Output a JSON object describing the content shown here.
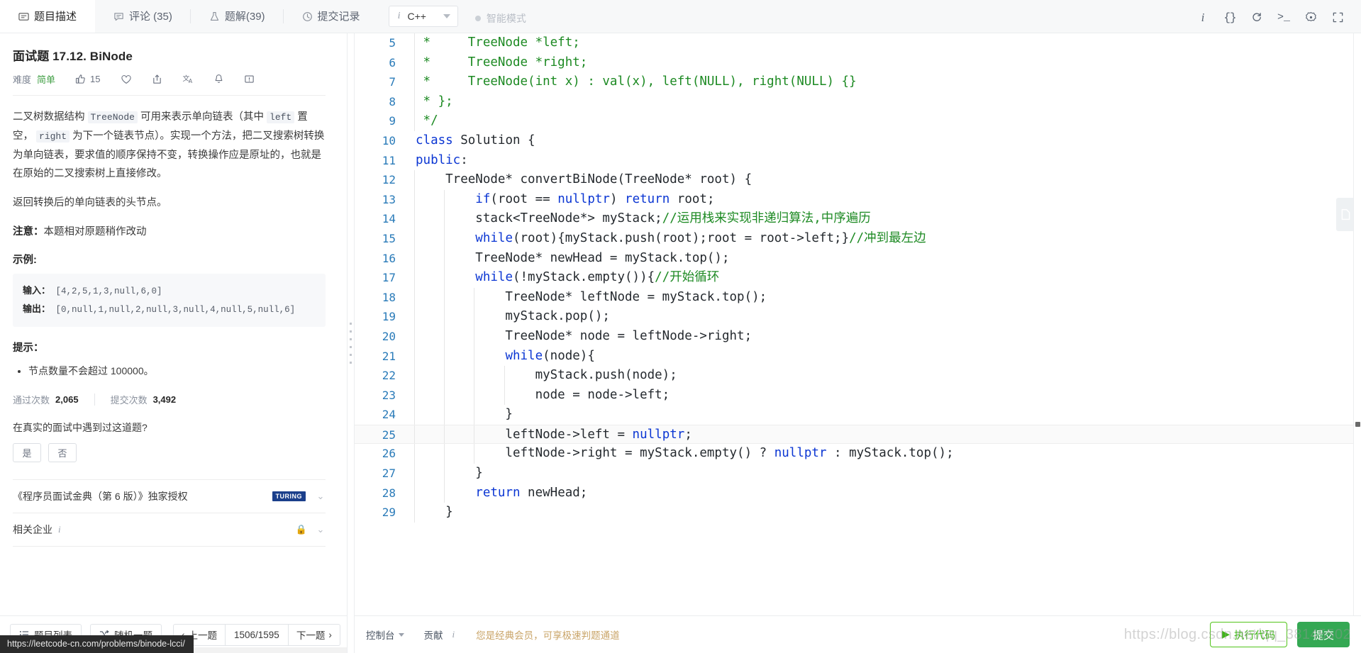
{
  "topbar": {
    "tabs": [
      {
        "label": "题目描述",
        "icon": "description-icon",
        "active": true
      },
      {
        "label": "评论 (35)",
        "icon": "comment-icon",
        "active": false
      },
      {
        "label": "题解(39)",
        "icon": "flask-icon",
        "active": false
      },
      {
        "label": "提交记录",
        "icon": "clock-icon",
        "active": false
      }
    ],
    "language": {
      "value": "C++",
      "info_mark": "i"
    },
    "smart_mode": {
      "label": "智能模式"
    },
    "tools": [
      {
        "name": "info-icon",
        "glyph": "i"
      },
      {
        "name": "format-braces-icon",
        "glyph": "{}"
      },
      {
        "name": "reset-icon",
        "glyph": "↺"
      },
      {
        "name": "console-icon",
        "glyph": ">_"
      },
      {
        "name": "settings-gear-icon",
        "glyph": "⚙"
      },
      {
        "name": "fullscreen-icon",
        "glyph": "⛶"
      }
    ]
  },
  "problem": {
    "title": "面试题 17.12. BiNode",
    "difficulty_label": "难度",
    "difficulty_value": "简单",
    "like_count": "15",
    "actions": [
      "thumbs-up",
      "heart",
      "share",
      "translate",
      "bell",
      "feedback"
    ],
    "desc_p1_a": "二叉树数据结构 ",
    "desc_code_treenode": "TreeNode",
    "desc_p1_b": " 可用来表示单向链表（其中 ",
    "desc_code_left": "left",
    "desc_p1_c": " 置空， ",
    "desc_code_right": "right",
    "desc_p1_d": " 为下一个链表节点）。实现一个方法，把二叉搜索树转换为单向链表，要求值的顺序保持不变，转换操作应是原址的，也就是在原始的二叉搜索树上直接修改。",
    "desc_p2": "返回转换后的单向链表的头节点。",
    "note_label": "注意：",
    "note_text": "本题相对原题稍作改动",
    "example_heading": "示例:",
    "example_input_label": "输入：",
    "example_input_value": "[4,2,5,1,3,null,6,0]",
    "example_output_label": "输出：",
    "example_output_value": "[0,null,1,null,2,null,3,null,4,null,5,null,6]",
    "hint_heading": "提示：",
    "hints": [
      "节点数量不会超过 100000。"
    ],
    "stats": {
      "accepted_label": "通过次数",
      "accepted_value": "2,065",
      "submitted_label": "提交次数",
      "submitted_value": "3,492"
    },
    "interview_question": "在真实的面试中遇到过这道题?",
    "yes_label": "是",
    "no_label": "否",
    "copyright_row": "《程序员面试金典（第 6 版）》独家授权",
    "turing_logo": "TURING",
    "companies_row": "相关企业"
  },
  "left_bottom": {
    "problem_list_label": "题目列表",
    "random_label": "随机一题",
    "prev_label": "上一题",
    "page_indicator": "1506/1595",
    "next_label": "下一题"
  },
  "editor": {
    "lines": [
      {
        "num": "5",
        "indent": 1,
        "tokens": [
          {
            "t": " *     TreeNode *left;",
            "c": "cmt"
          }
        ]
      },
      {
        "num": "6",
        "indent": 1,
        "tokens": [
          {
            "t": " *     TreeNode *right;",
            "c": "cmt"
          }
        ]
      },
      {
        "num": "7",
        "indent": 1,
        "tokens": [
          {
            "t": " *     TreeNode(int x) : val(x), left(NULL), right(NULL) {}",
            "c": "cmt"
          }
        ]
      },
      {
        "num": "8",
        "indent": 1,
        "tokens": [
          {
            "t": " * };",
            "c": "cmt"
          }
        ]
      },
      {
        "num": "9",
        "indent": 1,
        "tokens": [
          {
            "t": " */",
            "c": "cmt"
          }
        ]
      },
      {
        "num": "10",
        "indent": 0,
        "tokens": [
          {
            "t": "class",
            "c": "kw"
          },
          {
            "t": " Solution {",
            "c": ""
          }
        ]
      },
      {
        "num": "11",
        "indent": 0,
        "tokens": [
          {
            "t": "public",
            "c": "kw"
          },
          {
            "t": ":",
            "c": ""
          }
        ]
      },
      {
        "num": "12",
        "indent": 1,
        "tokens": [
          {
            "t": "    TreeNode* convertBiNode(TreeNode* root) {",
            "c": ""
          }
        ]
      },
      {
        "num": "13",
        "indent": 2,
        "tokens": [
          {
            "t": "        ",
            "c": ""
          },
          {
            "t": "if",
            "c": "kw"
          },
          {
            "t": "(root == ",
            "c": ""
          },
          {
            "t": "nullptr",
            "c": "kw"
          },
          {
            "t": ") ",
            "c": ""
          },
          {
            "t": "return",
            "c": "kw"
          },
          {
            "t": " root;",
            "c": ""
          }
        ]
      },
      {
        "num": "14",
        "indent": 2,
        "tokens": [
          {
            "t": "        stack<TreeNode*> myStack;",
            "c": ""
          },
          {
            "t": "//运用栈来实现非递归算法,中序遍历",
            "c": "cmt"
          }
        ]
      },
      {
        "num": "15",
        "indent": 2,
        "tokens": [
          {
            "t": "        ",
            "c": ""
          },
          {
            "t": "while",
            "c": "kw"
          },
          {
            "t": "(root){myStack.push(root);root = root->left;}",
            "c": ""
          },
          {
            "t": "//冲到最左边",
            "c": "cmt"
          }
        ]
      },
      {
        "num": "16",
        "indent": 2,
        "tokens": [
          {
            "t": "        TreeNode* newHead = myStack.top();",
            "c": ""
          }
        ]
      },
      {
        "num": "17",
        "indent": 2,
        "tokens": [
          {
            "t": "        ",
            "c": ""
          },
          {
            "t": "while",
            "c": "kw"
          },
          {
            "t": "(!myStack.empty()){",
            "c": ""
          },
          {
            "t": "//开始循环",
            "c": "cmt"
          }
        ]
      },
      {
        "num": "18",
        "indent": 3,
        "tokens": [
          {
            "t": "            TreeNode* leftNode = myStack.top();",
            "c": ""
          }
        ]
      },
      {
        "num": "19",
        "indent": 3,
        "tokens": [
          {
            "t": "            myStack.pop();",
            "c": ""
          }
        ]
      },
      {
        "num": "20",
        "indent": 3,
        "tokens": [
          {
            "t": "            TreeNode* node = leftNode->right;",
            "c": ""
          }
        ]
      },
      {
        "num": "21",
        "indent": 3,
        "tokens": [
          {
            "t": "            ",
            "c": ""
          },
          {
            "t": "while",
            "c": "kw"
          },
          {
            "t": "(node){",
            "c": ""
          }
        ]
      },
      {
        "num": "22",
        "indent": 4,
        "tokens": [
          {
            "t": "                myStack.push(node);",
            "c": ""
          }
        ]
      },
      {
        "num": "23",
        "indent": 4,
        "tokens": [
          {
            "t": "                node = node->left;",
            "c": ""
          }
        ]
      },
      {
        "num": "24",
        "indent": 3,
        "tokens": [
          {
            "t": "            }",
            "c": ""
          }
        ]
      },
      {
        "num": "25",
        "indent": 3,
        "current": true,
        "tokens": [
          {
            "t": "            leftNode->left = ",
            "c": ""
          },
          {
            "t": "nullptr",
            "c": "kw"
          },
          {
            "t": ";",
            "c": ""
          }
        ]
      },
      {
        "num": "26",
        "indent": 3,
        "tokens": [
          {
            "t": "            leftNode->right = myStack.empty() ? ",
            "c": ""
          },
          {
            "t": "nullptr",
            "c": "kw"
          },
          {
            "t": " : myStack.top();",
            "c": ""
          }
        ]
      },
      {
        "num": "27",
        "indent": 2,
        "tokens": [
          {
            "t": "        }",
            "c": ""
          }
        ]
      },
      {
        "num": "28",
        "indent": 2,
        "tokens": [
          {
            "t": "        ",
            "c": ""
          },
          {
            "t": "return",
            "c": "kw"
          },
          {
            "t": " newHead;",
            "c": ""
          }
        ]
      },
      {
        "num": "29",
        "indent": 1,
        "tokens": [
          {
            "t": "    }",
            "c": ""
          }
        ]
      }
    ]
  },
  "editor_bottom": {
    "console_label": "控制台",
    "contribute_label": "贡献",
    "vip_note": "您是经典会员，可享极速判题通道",
    "run_label": "执行代码",
    "submit_label": "提交"
  },
  "status_url": "https://leetcode-cn.com/problems/binode-lcci/",
  "watermark": "https://blog.csdn.net/qq_38145502",
  "colors": {
    "accent_green": "#34a853",
    "difficulty_easy": "#43a047",
    "comment_green": "#1d8a23",
    "keyword_blue": "#0b36d3",
    "line_number": "#2a7bb9",
    "vip_gold": "#c9a467"
  }
}
